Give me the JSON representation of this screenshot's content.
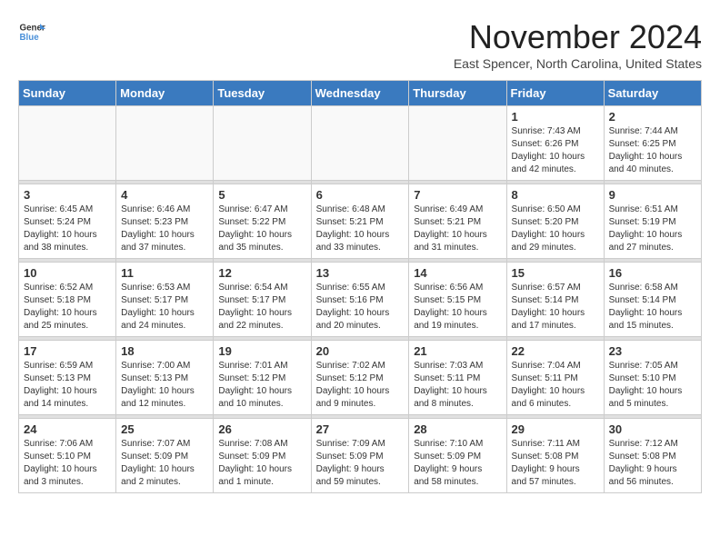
{
  "header": {
    "logo_general": "General",
    "logo_blue": "Blue",
    "month_title": "November 2024",
    "location": "East Spencer, North Carolina, United States"
  },
  "weekdays": [
    "Sunday",
    "Monday",
    "Tuesday",
    "Wednesday",
    "Thursday",
    "Friday",
    "Saturday"
  ],
  "weeks": [
    [
      {
        "day": "",
        "info": ""
      },
      {
        "day": "",
        "info": ""
      },
      {
        "day": "",
        "info": ""
      },
      {
        "day": "",
        "info": ""
      },
      {
        "day": "",
        "info": ""
      },
      {
        "day": "1",
        "info": "Sunrise: 7:43 AM\nSunset: 6:26 PM\nDaylight: 10 hours\nand 42 minutes."
      },
      {
        "day": "2",
        "info": "Sunrise: 7:44 AM\nSunset: 6:25 PM\nDaylight: 10 hours\nand 40 minutes."
      }
    ],
    [
      {
        "day": "3",
        "info": "Sunrise: 6:45 AM\nSunset: 5:24 PM\nDaylight: 10 hours\nand 38 minutes."
      },
      {
        "day": "4",
        "info": "Sunrise: 6:46 AM\nSunset: 5:23 PM\nDaylight: 10 hours\nand 37 minutes."
      },
      {
        "day": "5",
        "info": "Sunrise: 6:47 AM\nSunset: 5:22 PM\nDaylight: 10 hours\nand 35 minutes."
      },
      {
        "day": "6",
        "info": "Sunrise: 6:48 AM\nSunset: 5:21 PM\nDaylight: 10 hours\nand 33 minutes."
      },
      {
        "day": "7",
        "info": "Sunrise: 6:49 AM\nSunset: 5:21 PM\nDaylight: 10 hours\nand 31 minutes."
      },
      {
        "day": "8",
        "info": "Sunrise: 6:50 AM\nSunset: 5:20 PM\nDaylight: 10 hours\nand 29 minutes."
      },
      {
        "day": "9",
        "info": "Sunrise: 6:51 AM\nSunset: 5:19 PM\nDaylight: 10 hours\nand 27 minutes."
      }
    ],
    [
      {
        "day": "10",
        "info": "Sunrise: 6:52 AM\nSunset: 5:18 PM\nDaylight: 10 hours\nand 25 minutes."
      },
      {
        "day": "11",
        "info": "Sunrise: 6:53 AM\nSunset: 5:17 PM\nDaylight: 10 hours\nand 24 minutes."
      },
      {
        "day": "12",
        "info": "Sunrise: 6:54 AM\nSunset: 5:17 PM\nDaylight: 10 hours\nand 22 minutes."
      },
      {
        "day": "13",
        "info": "Sunrise: 6:55 AM\nSunset: 5:16 PM\nDaylight: 10 hours\nand 20 minutes."
      },
      {
        "day": "14",
        "info": "Sunrise: 6:56 AM\nSunset: 5:15 PM\nDaylight: 10 hours\nand 19 minutes."
      },
      {
        "day": "15",
        "info": "Sunrise: 6:57 AM\nSunset: 5:14 PM\nDaylight: 10 hours\nand 17 minutes."
      },
      {
        "day": "16",
        "info": "Sunrise: 6:58 AM\nSunset: 5:14 PM\nDaylight: 10 hours\nand 15 minutes."
      }
    ],
    [
      {
        "day": "17",
        "info": "Sunrise: 6:59 AM\nSunset: 5:13 PM\nDaylight: 10 hours\nand 14 minutes."
      },
      {
        "day": "18",
        "info": "Sunrise: 7:00 AM\nSunset: 5:13 PM\nDaylight: 10 hours\nand 12 minutes."
      },
      {
        "day": "19",
        "info": "Sunrise: 7:01 AM\nSunset: 5:12 PM\nDaylight: 10 hours\nand 10 minutes."
      },
      {
        "day": "20",
        "info": "Sunrise: 7:02 AM\nSunset: 5:12 PM\nDaylight: 10 hours\nand 9 minutes."
      },
      {
        "day": "21",
        "info": "Sunrise: 7:03 AM\nSunset: 5:11 PM\nDaylight: 10 hours\nand 8 minutes."
      },
      {
        "day": "22",
        "info": "Sunrise: 7:04 AM\nSunset: 5:11 PM\nDaylight: 10 hours\nand 6 minutes."
      },
      {
        "day": "23",
        "info": "Sunrise: 7:05 AM\nSunset: 5:10 PM\nDaylight: 10 hours\nand 5 minutes."
      }
    ],
    [
      {
        "day": "24",
        "info": "Sunrise: 7:06 AM\nSunset: 5:10 PM\nDaylight: 10 hours\nand 3 minutes."
      },
      {
        "day": "25",
        "info": "Sunrise: 7:07 AM\nSunset: 5:09 PM\nDaylight: 10 hours\nand 2 minutes."
      },
      {
        "day": "26",
        "info": "Sunrise: 7:08 AM\nSunset: 5:09 PM\nDaylight: 10 hours\nand 1 minute."
      },
      {
        "day": "27",
        "info": "Sunrise: 7:09 AM\nSunset: 5:09 PM\nDaylight: 9 hours\nand 59 minutes."
      },
      {
        "day": "28",
        "info": "Sunrise: 7:10 AM\nSunset: 5:09 PM\nDaylight: 9 hours\nand 58 minutes."
      },
      {
        "day": "29",
        "info": "Sunrise: 7:11 AM\nSunset: 5:08 PM\nDaylight: 9 hours\nand 57 minutes."
      },
      {
        "day": "30",
        "info": "Sunrise: 7:12 AM\nSunset: 5:08 PM\nDaylight: 9 hours\nand 56 minutes."
      }
    ]
  ]
}
